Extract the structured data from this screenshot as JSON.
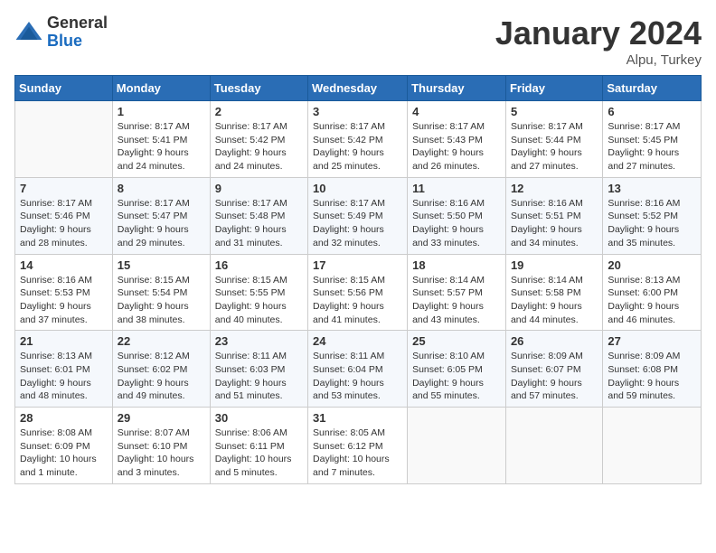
{
  "header": {
    "logo_general": "General",
    "logo_blue": "Blue",
    "month_title": "January 2024",
    "location": "Alpu, Turkey"
  },
  "weekdays": [
    "Sunday",
    "Monday",
    "Tuesday",
    "Wednesday",
    "Thursday",
    "Friday",
    "Saturday"
  ],
  "weeks": [
    [
      {
        "day": "",
        "sunrise": "",
        "sunset": "",
        "daylight": ""
      },
      {
        "day": "1",
        "sunrise": "Sunrise: 8:17 AM",
        "sunset": "Sunset: 5:41 PM",
        "daylight": "Daylight: 9 hours and 24 minutes."
      },
      {
        "day": "2",
        "sunrise": "Sunrise: 8:17 AM",
        "sunset": "Sunset: 5:42 PM",
        "daylight": "Daylight: 9 hours and 24 minutes."
      },
      {
        "day": "3",
        "sunrise": "Sunrise: 8:17 AM",
        "sunset": "Sunset: 5:42 PM",
        "daylight": "Daylight: 9 hours and 25 minutes."
      },
      {
        "day": "4",
        "sunrise": "Sunrise: 8:17 AM",
        "sunset": "Sunset: 5:43 PM",
        "daylight": "Daylight: 9 hours and 26 minutes."
      },
      {
        "day": "5",
        "sunrise": "Sunrise: 8:17 AM",
        "sunset": "Sunset: 5:44 PM",
        "daylight": "Daylight: 9 hours and 27 minutes."
      },
      {
        "day": "6",
        "sunrise": "Sunrise: 8:17 AM",
        "sunset": "Sunset: 5:45 PM",
        "daylight": "Daylight: 9 hours and 27 minutes."
      }
    ],
    [
      {
        "day": "7",
        "sunrise": "Sunrise: 8:17 AM",
        "sunset": "Sunset: 5:46 PM",
        "daylight": "Daylight: 9 hours and 28 minutes."
      },
      {
        "day": "8",
        "sunrise": "Sunrise: 8:17 AM",
        "sunset": "Sunset: 5:47 PM",
        "daylight": "Daylight: 9 hours and 29 minutes."
      },
      {
        "day": "9",
        "sunrise": "Sunrise: 8:17 AM",
        "sunset": "Sunset: 5:48 PM",
        "daylight": "Daylight: 9 hours and 31 minutes."
      },
      {
        "day": "10",
        "sunrise": "Sunrise: 8:17 AM",
        "sunset": "Sunset: 5:49 PM",
        "daylight": "Daylight: 9 hours and 32 minutes."
      },
      {
        "day": "11",
        "sunrise": "Sunrise: 8:16 AM",
        "sunset": "Sunset: 5:50 PM",
        "daylight": "Daylight: 9 hours and 33 minutes."
      },
      {
        "day": "12",
        "sunrise": "Sunrise: 8:16 AM",
        "sunset": "Sunset: 5:51 PM",
        "daylight": "Daylight: 9 hours and 34 minutes."
      },
      {
        "day": "13",
        "sunrise": "Sunrise: 8:16 AM",
        "sunset": "Sunset: 5:52 PM",
        "daylight": "Daylight: 9 hours and 35 minutes."
      }
    ],
    [
      {
        "day": "14",
        "sunrise": "Sunrise: 8:16 AM",
        "sunset": "Sunset: 5:53 PM",
        "daylight": "Daylight: 9 hours and 37 minutes."
      },
      {
        "day": "15",
        "sunrise": "Sunrise: 8:15 AM",
        "sunset": "Sunset: 5:54 PM",
        "daylight": "Daylight: 9 hours and 38 minutes."
      },
      {
        "day": "16",
        "sunrise": "Sunrise: 8:15 AM",
        "sunset": "Sunset: 5:55 PM",
        "daylight": "Daylight: 9 hours and 40 minutes."
      },
      {
        "day": "17",
        "sunrise": "Sunrise: 8:15 AM",
        "sunset": "Sunset: 5:56 PM",
        "daylight": "Daylight: 9 hours and 41 minutes."
      },
      {
        "day": "18",
        "sunrise": "Sunrise: 8:14 AM",
        "sunset": "Sunset: 5:57 PM",
        "daylight": "Daylight: 9 hours and 43 minutes."
      },
      {
        "day": "19",
        "sunrise": "Sunrise: 8:14 AM",
        "sunset": "Sunset: 5:58 PM",
        "daylight": "Daylight: 9 hours and 44 minutes."
      },
      {
        "day": "20",
        "sunrise": "Sunrise: 8:13 AM",
        "sunset": "Sunset: 6:00 PM",
        "daylight": "Daylight: 9 hours and 46 minutes."
      }
    ],
    [
      {
        "day": "21",
        "sunrise": "Sunrise: 8:13 AM",
        "sunset": "Sunset: 6:01 PM",
        "daylight": "Daylight: 9 hours and 48 minutes."
      },
      {
        "day": "22",
        "sunrise": "Sunrise: 8:12 AM",
        "sunset": "Sunset: 6:02 PM",
        "daylight": "Daylight: 9 hours and 49 minutes."
      },
      {
        "day": "23",
        "sunrise": "Sunrise: 8:11 AM",
        "sunset": "Sunset: 6:03 PM",
        "daylight": "Daylight: 9 hours and 51 minutes."
      },
      {
        "day": "24",
        "sunrise": "Sunrise: 8:11 AM",
        "sunset": "Sunset: 6:04 PM",
        "daylight": "Daylight: 9 hours and 53 minutes."
      },
      {
        "day": "25",
        "sunrise": "Sunrise: 8:10 AM",
        "sunset": "Sunset: 6:05 PM",
        "daylight": "Daylight: 9 hours and 55 minutes."
      },
      {
        "day": "26",
        "sunrise": "Sunrise: 8:09 AM",
        "sunset": "Sunset: 6:07 PM",
        "daylight": "Daylight: 9 hours and 57 minutes."
      },
      {
        "day": "27",
        "sunrise": "Sunrise: 8:09 AM",
        "sunset": "Sunset: 6:08 PM",
        "daylight": "Daylight: 9 hours and 59 minutes."
      }
    ],
    [
      {
        "day": "28",
        "sunrise": "Sunrise: 8:08 AM",
        "sunset": "Sunset: 6:09 PM",
        "daylight": "Daylight: 10 hours and 1 minute."
      },
      {
        "day": "29",
        "sunrise": "Sunrise: 8:07 AM",
        "sunset": "Sunset: 6:10 PM",
        "daylight": "Daylight: 10 hours and 3 minutes."
      },
      {
        "day": "30",
        "sunrise": "Sunrise: 8:06 AM",
        "sunset": "Sunset: 6:11 PM",
        "daylight": "Daylight: 10 hours and 5 minutes."
      },
      {
        "day": "31",
        "sunrise": "Sunrise: 8:05 AM",
        "sunset": "Sunset: 6:12 PM",
        "daylight": "Daylight: 10 hours and 7 minutes."
      },
      {
        "day": "",
        "sunrise": "",
        "sunset": "",
        "daylight": ""
      },
      {
        "day": "",
        "sunrise": "",
        "sunset": "",
        "daylight": ""
      },
      {
        "day": "",
        "sunrise": "",
        "sunset": "",
        "daylight": ""
      }
    ]
  ]
}
